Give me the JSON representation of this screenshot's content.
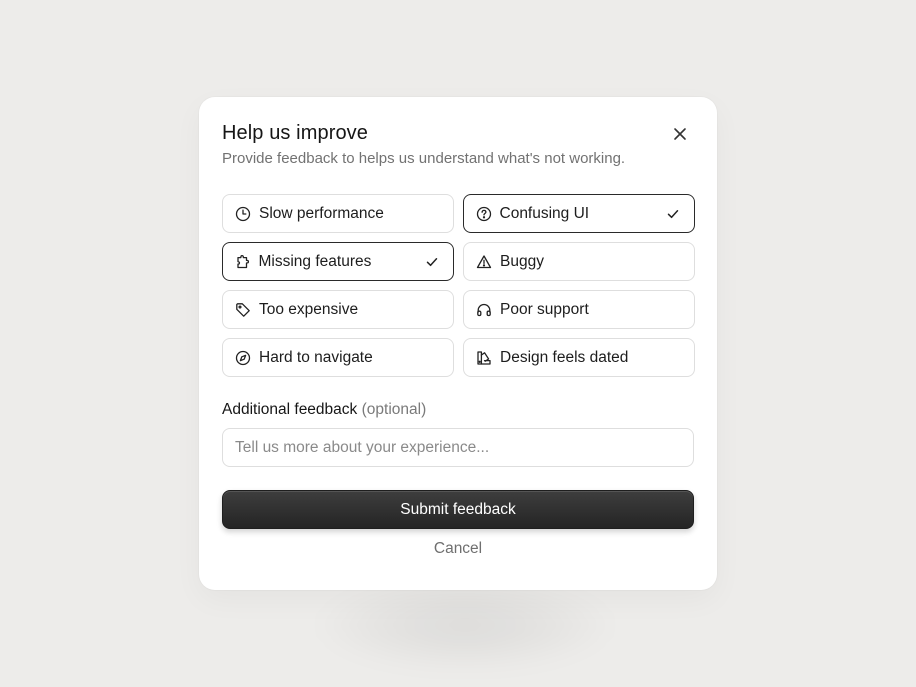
{
  "dialog": {
    "title": "Help us improve",
    "subtitle": "Provide feedback to helps us understand what's not working.",
    "close_icon": "close-icon"
  },
  "options": [
    {
      "label": "Slow performance",
      "icon": "clock-icon",
      "selected": false
    },
    {
      "label": "Confusing UI",
      "icon": "question-circle-icon",
      "selected": true
    },
    {
      "label": "Missing features",
      "icon": "puzzle-icon",
      "selected": true
    },
    {
      "label": "Buggy",
      "icon": "warning-triangle-icon",
      "selected": false
    },
    {
      "label": "Too expensive",
      "icon": "tag-icon",
      "selected": false
    },
    {
      "label": "Poor support",
      "icon": "headphones-icon",
      "selected": false
    },
    {
      "label": "Hard to navigate",
      "icon": "compass-icon",
      "selected": false
    },
    {
      "label": "Design feels dated",
      "icon": "swatches-icon",
      "selected": false
    }
  ],
  "additional": {
    "label": "Additional feedback",
    "optional": "(optional)",
    "placeholder": "Tell us more about your experience...",
    "value": ""
  },
  "actions": {
    "submit_label": "Submit feedback",
    "cancel_label": "Cancel"
  },
  "colors": {
    "background": "#edecea",
    "card": "#ffffff",
    "border": "#dedede",
    "selected_border": "#2a2a2a",
    "primary_button": "#2e2e2e"
  }
}
